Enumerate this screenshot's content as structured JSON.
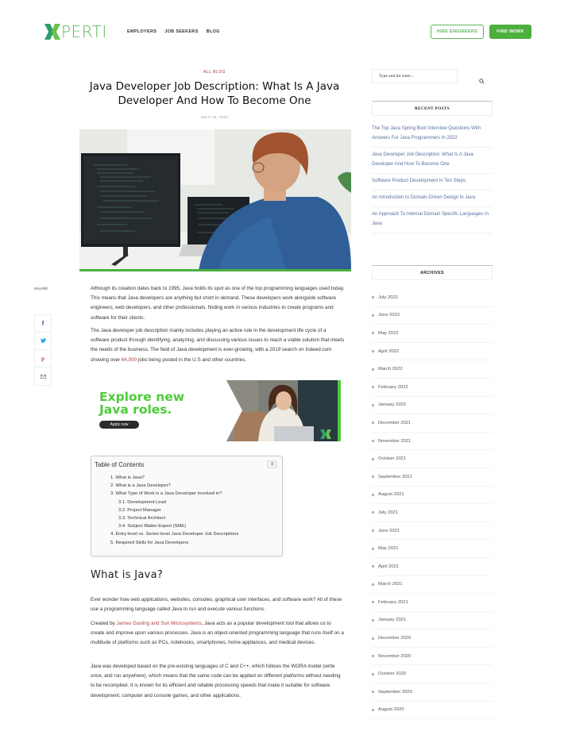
{
  "header": {
    "logo_text": "PERTI",
    "nav": [
      "EMPLOYERS",
      "JOB SEEKERS",
      "BLOG"
    ],
    "hire_button": "HIRE ENGINEERS",
    "find_button": "FIND WORK",
    "brand_color": "#4caf3e"
  },
  "article": {
    "category": "ALL BLOG",
    "title": "Java Developer Job Description: What Is A Java Developer And How To Become One",
    "date": "JULY 16, 2022",
    "p1": "Although its creation dates back to 1995, Java holds its spot as one of the top programming languages used today. This means that Java developers are anything but short in demand. These developers work alongside software engineers, web developers, and other professionals, finding work in various industries to create programs and software for their clients.",
    "p2_before": "The Java developer job description mainly includes playing an active role in the development life cycle of a software product through identifying, analyzing, and discussing various issues to reach a viable solution that meets the needs of the business. The field of Java development is ever-growing, with a 2019 search on Indeed.com showing over ",
    "p2_link": "64,000",
    "p2_after": " jobs being posted in the U.S and other countries.",
    "ad": {
      "headline_line1": "Explore new",
      "headline_line2": "Java roles.",
      "button": "Apply now"
    },
    "toc": {
      "title": "Table of Contents",
      "items": [
        {
          "label": "1. What is Java?",
          "sub": false
        },
        {
          "label": "2. What is a Java Developer?",
          "sub": false
        },
        {
          "label": "3. What Type of Work is a Java Developer Involved in?",
          "sub": false
        },
        {
          "label": "3.1. Development Lead",
          "sub": true
        },
        {
          "label": "3.2. Project Manager",
          "sub": true
        },
        {
          "label": "3.3. Technical Architect",
          "sub": true
        },
        {
          "label": "3.4. Subject Matter Expert (SME)",
          "sub": true
        },
        {
          "label": "4. Entry-level vs. Senior-level Java Developer Job Descriptions",
          "sub": false
        },
        {
          "label": "5. Required Skills for Java Developers",
          "sub": false
        }
      ]
    },
    "h2_java": "What is Java?",
    "p3": "Ever wonder how web applications, websites, consoles, graphical user interfaces, and software work? All of these use a programming language called Java to run and execute various functions.",
    "p4_before": "Created by ",
    "p4_link": "James Gosling and Sun Microsystems",
    "p4_after": ", Java acts as a popular development tool that allows us to create and improve upon various processes. Java is an object-oriented programming language that runs itself on a multitude of platforms such as PCs, notebooks, smartphones, home appliances, and medical devices.",
    "p5": "Java was developed based on the pre-existing languages of C and C++, which follows the WORA model (write once, and run anywhere), which means that the same code can be applied on different platforms without needing to be recompiled. It is known for its efficient and reliable processing speeds that make it suitable for software development, computer and console games, and other applications.",
    "h2_dev": "What is a Java Developer?"
  },
  "share": {
    "label": "SHARE",
    "buttons": [
      "facebook",
      "twitter",
      "pinterest",
      "email"
    ]
  },
  "sidebar": {
    "search_placeholder": "Type and hit enter...",
    "recent_title": "RECENT POSTS",
    "recent_posts": [
      "The Top Java Spring Boot Interview Questions With Answers For Java Programmers In 2022",
      "Java Developer Job Description: What Is A Java Developer And How To Become One",
      "Software Product Development In Ten Steps",
      "An Introduction to Domain-Driven Design In Java",
      "An Approach To Internal Domain Specific Languages In Java"
    ],
    "archives_title": "ARCHIVES",
    "archives": [
      "July 2022",
      "June 2022",
      "May 2022",
      "April 2022",
      "March 2022",
      "February 2022",
      "January 2022",
      "December 2021",
      "November 2021",
      "October 2021",
      "September 2021",
      "August 2021",
      "July 2021",
      "June 2021",
      "May 2021",
      "April 2021",
      "March 2021",
      "February 2021",
      "January 2021",
      "December 2020",
      "November 2020",
      "October 2020",
      "September 2020",
      "August 2020"
    ]
  }
}
